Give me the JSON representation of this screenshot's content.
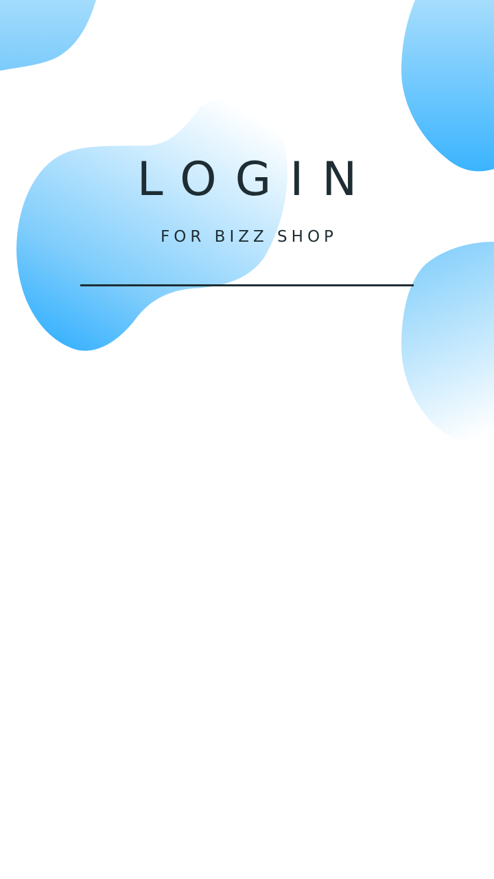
{
  "login": {
    "title": "LOGIN",
    "subtitle": "FOR BIZZ SHOP"
  },
  "colors": {
    "text": "#1e2d33",
    "blob_light": "#e8f6ff",
    "blob_mid": "#8fd3fb",
    "blob_dark": "#3db4fd",
    "background": "#ffffff"
  }
}
